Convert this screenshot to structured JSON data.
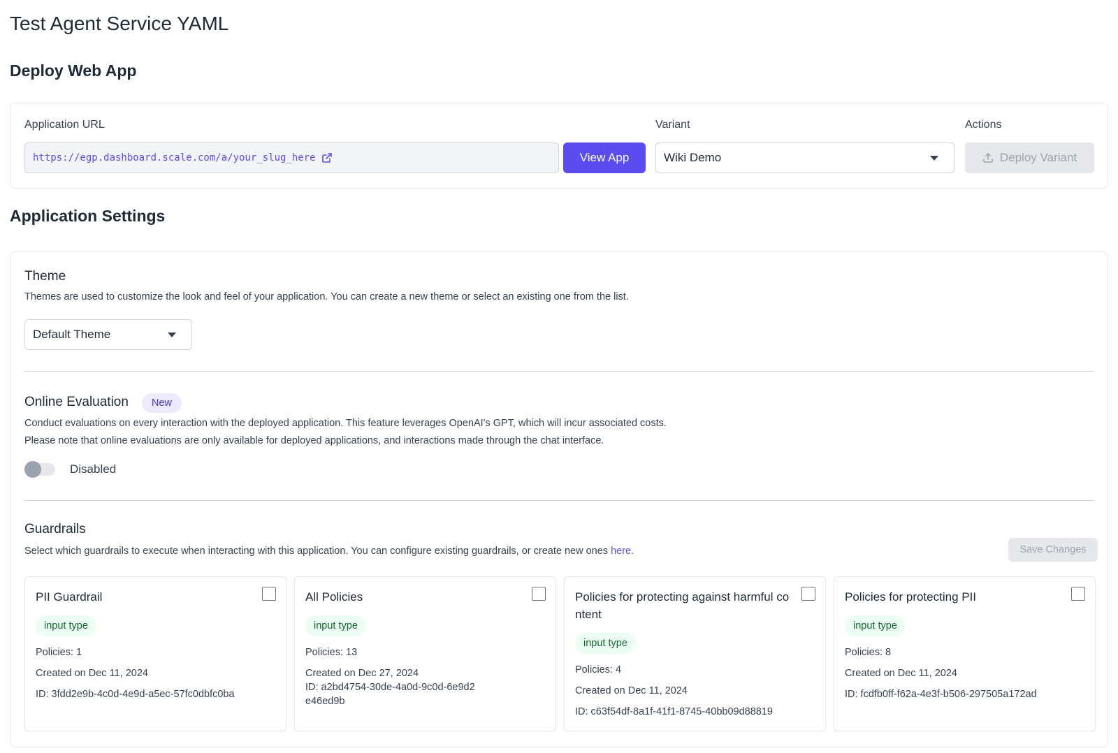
{
  "page": {
    "title": "Test Agent Service YAML"
  },
  "deploy": {
    "section_title": "Deploy Web App",
    "url_label": "Application URL",
    "url_value": "https://egp.dashboard.scale.com/a/your_slug_here",
    "view_app_label": "View App",
    "variant_label": "Variant",
    "variant_value": "Wiki Demo",
    "actions_label": "Actions",
    "deploy_variant_label": "Deploy Variant"
  },
  "settings": {
    "section_title": "Application Settings",
    "theme": {
      "title": "Theme",
      "description": "Themes are used to customize the look and feel of your application. You can create a new theme or select an existing one from the list.",
      "selected": "Default Theme"
    },
    "online_eval": {
      "title": "Online Evaluation",
      "badge": "New",
      "description_1": "Conduct evaluations on every interaction with the deployed application. This feature leverages OpenAI's GPT, which will incur associated costs.",
      "description_2": "Please note that online evaluations are only available for deployed applications, and interactions made through the chat interface.",
      "toggle_label": "Disabled",
      "enabled": false
    },
    "guardrails": {
      "title": "Guardrails",
      "description": "Select which guardrails to execute when interacting with this application. You can configure existing guardrails, or create new ones ",
      "link_text": "here",
      "link_suffix": ".",
      "save_label": "Save Changes",
      "cards": [
        {
          "name": "PII Guardrail",
          "type": "input type",
          "policies": "Policies: 1",
          "created": "Created on Dec 11, 2024",
          "id": "ID: 3fdd2e9b-4c0d-4e9d-a5ec-57fc0dbfc0ba"
        },
        {
          "name": "All Policies",
          "type": "input type",
          "policies": "Policies: 13",
          "created": "Created on Dec 27, 2024",
          "id": "ID: a2bd4754-30de-4a0d-9c0d-6e9d2e46ed9b"
        },
        {
          "name": "Policies for protecting against harmful content",
          "type": "input type",
          "policies": "Policies: 4",
          "created": "Created on Dec 11, 2024",
          "id": "ID: c63f54df-8a1f-41f1-8745-40bb09d88819"
        },
        {
          "name": "Policies for protecting PII",
          "type": "input type",
          "policies": "Policies: 8",
          "created": "Created on Dec 11, 2024",
          "id": "ID: fcdfb0ff-f62a-4e3f-b506-297505a172ad"
        }
      ]
    }
  },
  "colors": {
    "accent": "#5b4cf0",
    "badge_new_bg": "#ede9fe",
    "badge_type_bg": "#ecfdf3"
  },
  "icons": {
    "external_link": "external-link-icon",
    "upload": "upload-icon",
    "caret": "chevron-down-icon"
  }
}
